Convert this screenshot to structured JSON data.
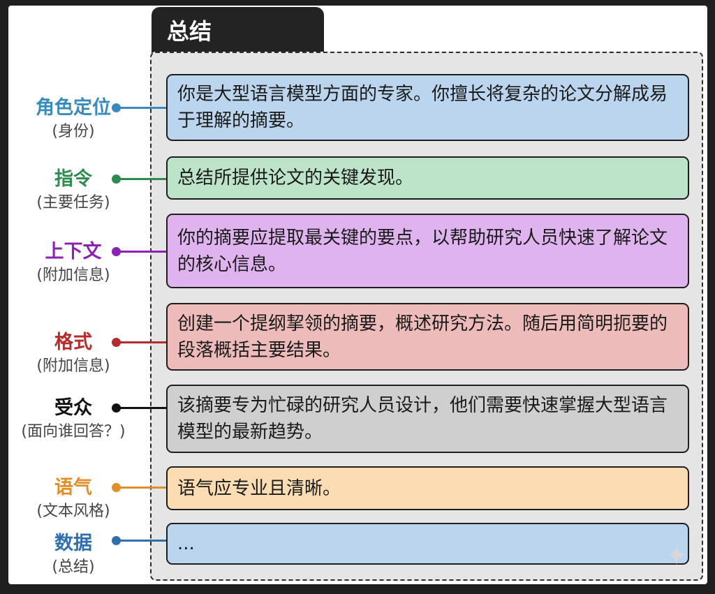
{
  "tab_title": "总结",
  "rows": [
    {
      "label": "角色定位",
      "sub": "(身份)",
      "text": "你是大型语言模型方面的专家。你擅长将复杂的论文分解成易于理解的摘要。",
      "color": "#3a8bbd",
      "fill": "#bad5ed"
    },
    {
      "label": "指令",
      "sub": "(主要任务)",
      "text": "总结所提供论文的关键发现。",
      "color": "#2e8b4e",
      "fill": "#bde3c9"
    },
    {
      "label": "上下文",
      "sub": "(附加信息)",
      "text": "你的摘要应提取最关键的要点，以帮助研究人员快速了解论文的核心信息。",
      "color": "#8c21b6",
      "fill": "#dfb3ee"
    },
    {
      "label": "格式",
      "sub": "(附加信息)",
      "text": "创建一个提纲挈领的摘要，概述研究方法。随后用简明扼要的段落概括主要结果。",
      "color": "#b42c2c",
      "fill": "#eebbbb"
    },
    {
      "label": "受众",
      "sub": "(面向谁回答？)",
      "text": "该摘要专为忙碌的研究人员设计，他们需要快速掌握大型语言模型的最新趋势。",
      "color": "#111111",
      "fill": "#cfcfcf"
    },
    {
      "label": "语气",
      "sub": "(文本风格)",
      "text": "语气应专业且清晰。",
      "color": "#e08f2a",
      "fill": "#fbdcb3"
    },
    {
      "label": "数据",
      "sub": "(总结)",
      "text": "...",
      "color": "#2f6fb0",
      "fill": "#bad5ed"
    }
  ]
}
